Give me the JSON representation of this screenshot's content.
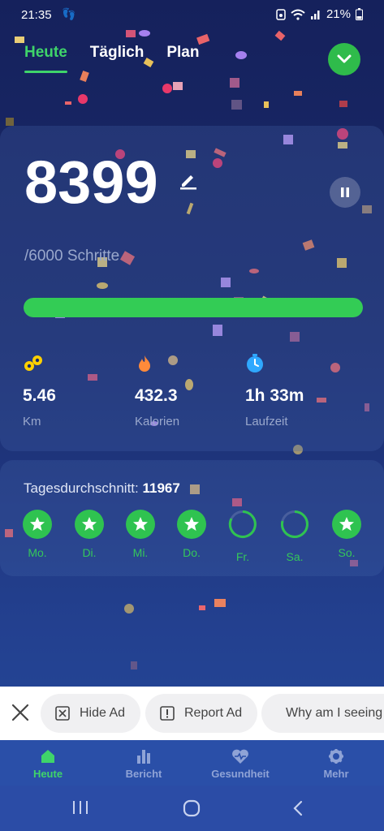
{
  "status_bar": {
    "time": "21:35",
    "battery": "21%",
    "icons": [
      "steps-icon",
      "screenshot-icon",
      "wifi-icon",
      "signal-icon",
      "battery-icon"
    ]
  },
  "tabs": [
    {
      "label": "Heute",
      "active": true
    },
    {
      "label": "Täglich",
      "active": false
    },
    {
      "label": "Plan",
      "active": false
    }
  ],
  "summary": {
    "steps": "8399",
    "goal": "/6000 Schritte",
    "progress": 1.0,
    "stats": [
      {
        "value": "5.46",
        "label": "Km",
        "icon": "distance-icon"
      },
      {
        "value": "432.3",
        "label": "Kalorien",
        "icon": "flame-icon"
      },
      {
        "value": "1h 33m",
        "label": "Laufzeit",
        "icon": "clock-icon"
      }
    ]
  },
  "weekly": {
    "avg_label": "Tagesdurchschnitt:",
    "avg_value": "11967",
    "days": [
      {
        "label": "Mo.",
        "done": true
      },
      {
        "label": "Di.",
        "done": true
      },
      {
        "label": "Mi.",
        "done": true
      },
      {
        "label": "Do.",
        "done": true
      },
      {
        "label": "Fr.",
        "done": false
      },
      {
        "label": "Sa.",
        "done": false
      },
      {
        "label": "So.",
        "done": true
      }
    ]
  },
  "ad_bar": {
    "hide": "Hide Ad",
    "report": "Report Ad",
    "why": "Why am I seeing this ad?"
  },
  "bottom_nav": [
    {
      "label": "Heute",
      "icon": "home-icon",
      "active": true
    },
    {
      "label": "Bericht",
      "icon": "bar-chart-icon",
      "active": false
    },
    {
      "label": "Gesundheit",
      "icon": "heart-icon",
      "active": false
    },
    {
      "label": "Mehr",
      "icon": "gear-icon",
      "active": false
    }
  ],
  "colors": {
    "accent": "#33cc55",
    "background": "#1b2b6c",
    "muted": "#9aa8cc"
  }
}
